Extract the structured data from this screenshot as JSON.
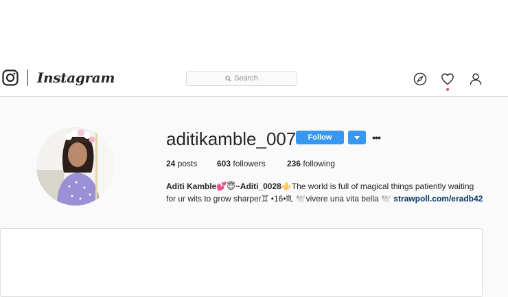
{
  "navbar": {
    "brand": "Instagram",
    "search_placeholder": "Search",
    "icons": [
      "instagram-glyph-icon",
      "compass-icon",
      "heart-icon",
      "user-icon"
    ]
  },
  "profile": {
    "username": "aditikamble_007",
    "follow_label": "Follow",
    "more_label": "•••",
    "stats": {
      "posts_count": "24",
      "posts_label": "posts",
      "followers_count": "603",
      "followers_label": "followers",
      "following_count": "236",
      "following_label": "following"
    },
    "bio": {
      "name": "Aditi Kamble💕😇~Aditi_0028",
      "line1_rest": "⚜️The world is full of magical things patiently waiting",
      "line2": "for ur wits to grow sharper♊ •16•♏ 🕊️vivere una vita bella 🕊️",
      "link": "strawpoll.com/eradb42"
    }
  },
  "colors": {
    "accent": "#3897f0",
    "link": "#003569",
    "border": "#dbdbdb",
    "background": "#fafafa",
    "notification": "#ed4956"
  }
}
